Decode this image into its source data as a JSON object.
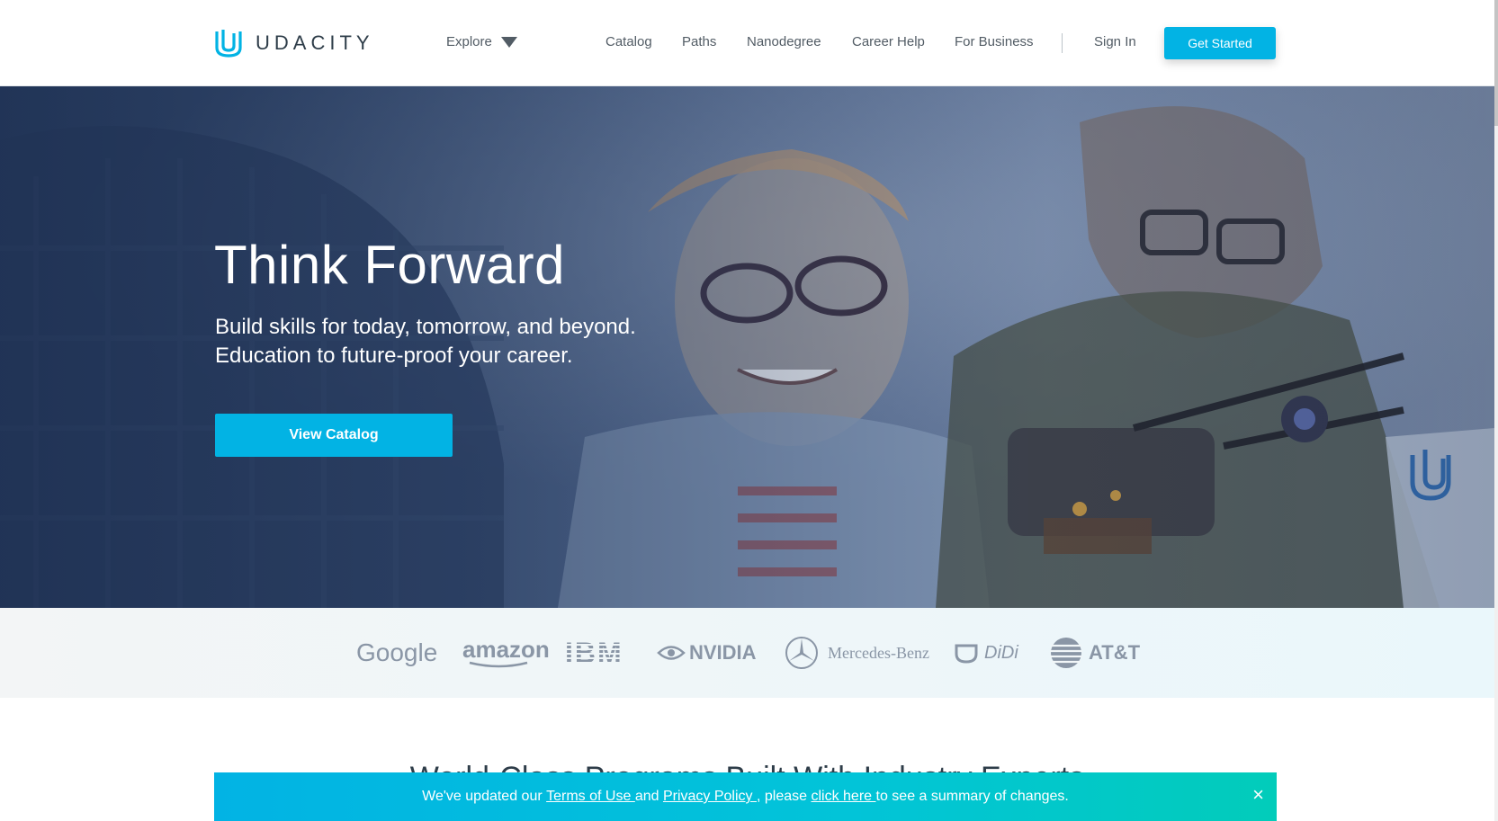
{
  "header": {
    "logo_text": "UDACITY",
    "explore_label": "Explore",
    "nav": [
      "Catalog",
      "Paths",
      "Nanodegree",
      "Career Help",
      "For Business"
    ],
    "sign_in": "Sign In",
    "get_started": "Get Started"
  },
  "hero": {
    "title": "Think Forward",
    "subtitle_line1": "Build skills for today, tomorrow, and beyond.",
    "subtitle_line2": "Education to future-proof your career.",
    "cta": "View Catalog"
  },
  "partners": [
    "Google",
    "amazon",
    "IBM",
    "NVIDIA",
    "Mercedes-Benz",
    "DiDi",
    "AT&T"
  ],
  "section_title": "World-Class Programs Built With Industry Experts",
  "notice": {
    "text_1": "We've updated our ",
    "terms": "Terms of Use ",
    "text_2": "and ",
    "privacy": "Privacy Policy ",
    "text_3": ", please ",
    "click_here": "click here ",
    "text_4": "to see a summary of changes.",
    "close": "×"
  },
  "colors": {
    "brand": "#02b3e4",
    "text": "#2e3d49",
    "nav_text": "#525c65"
  }
}
